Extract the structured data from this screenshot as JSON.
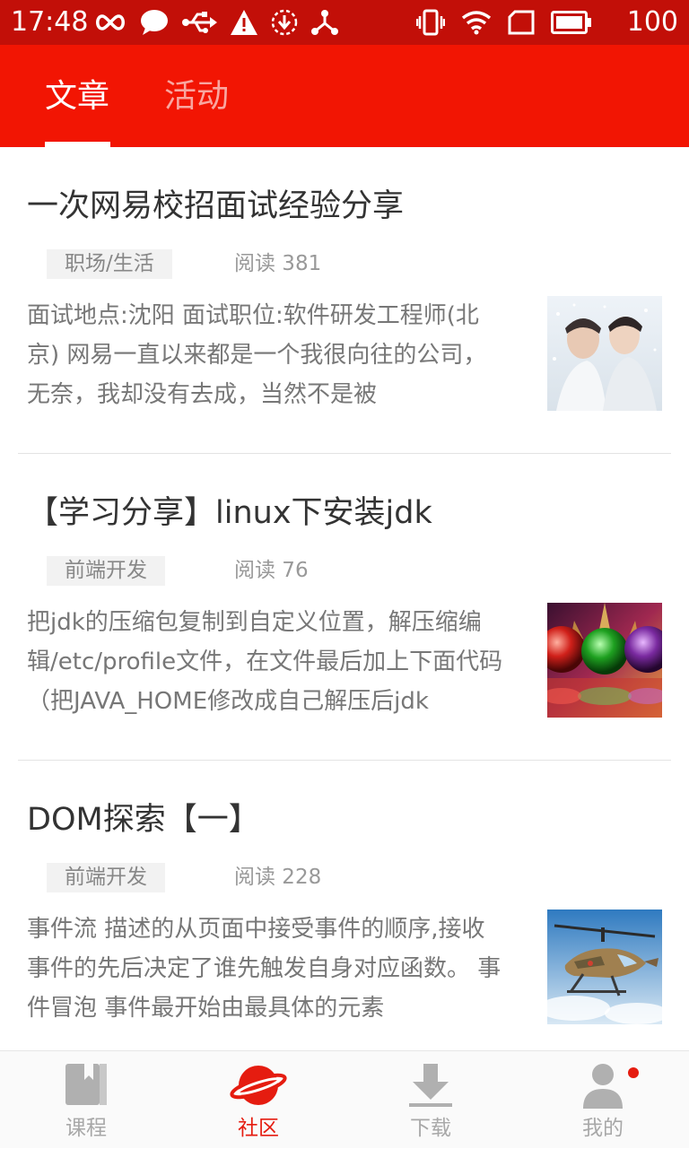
{
  "status_bar": {
    "time": "17:48",
    "battery": "100",
    "icons": [
      "infinity-icon",
      "chat-bubble-icon",
      "usb-icon",
      "warning-icon",
      "download-circle-icon",
      "network-icon",
      "vibrate-icon",
      "wifi-icon",
      "sim-icon",
      "battery-icon"
    ]
  },
  "header": {
    "tabs": [
      {
        "label": "文章",
        "active": true
      },
      {
        "label": "活动",
        "active": false
      }
    ],
    "background": "#f21503"
  },
  "articles": [
    {
      "title": "一次网易校招面试经验分享",
      "tag": "职场/生活",
      "reads": "阅读 381",
      "summary": "面试地点:沈阳 面试职位:软件研发工程师(北京) 网易一直以来都是一个我很向往的公司，无奈，我却没有去成，当然不是被",
      "thumbnail": "couple-snow-photo"
    },
    {
      "title": "【学习分享】linux下安装jdk",
      "tag": "前端开发",
      "reads": "阅读 76",
      "summary": "把jdk的压缩包复制到自定义位置，解压缩编辑/etc/profile文件，在文件最后加上下面代码（把JAVA_HOME修改成自己解压后jdk",
      "thumbnail": "glass-spheres-image"
    },
    {
      "title": "DOM探索【一】",
      "tag": "前端开发",
      "reads": "阅读 228",
      "summary": "事件流 描述的从页面中接受事件的顺序,接收事件的先后决定了谁先触发自身对应函数。 事件冒泡 事件最开始由最具体的元素",
      "thumbnail": "helicopter-painting"
    }
  ],
  "bottom_nav": {
    "items": [
      {
        "label": "课程",
        "icon": "book-icon",
        "active": false
      },
      {
        "label": "社区",
        "icon": "planet-icon",
        "active": true
      },
      {
        "label": "下载",
        "icon": "download-icon",
        "active": false
      },
      {
        "label": "我的",
        "icon": "user-icon",
        "active": false,
        "badge": true
      }
    ],
    "active_color": "#e51c10",
    "inactive_color": "#a8a8a8"
  }
}
